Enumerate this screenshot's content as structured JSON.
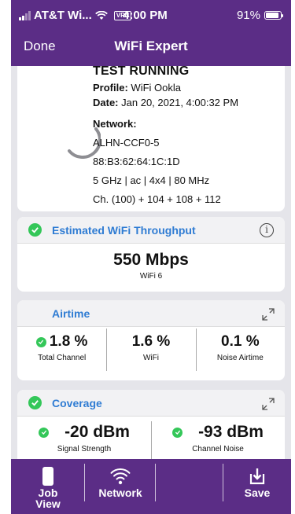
{
  "status_bar": {
    "carrier": "AT&T Wi...",
    "vpn": "VPN",
    "time": "4:00 PM",
    "battery": "91%"
  },
  "nav": {
    "done_label": "Done",
    "title": "WiFi Expert"
  },
  "test": {
    "status": "TEST RUNNING",
    "profile_label": "Profile:",
    "profile_value": "WiFi Ookla",
    "date_label": "Date:",
    "date_value": "Jan 20, 2021, 4:00:32 PM",
    "network_label": "Network:",
    "network_lines": [
      "ALHN-CCF0-5",
      "88:B3:62:64:1C:1D",
      "5 GHz | ac | 4x4 | 80 MHz",
      "Ch. (100) + 104 + 108 + 112"
    ]
  },
  "throughput": {
    "title": "Estimated WiFi Throughput",
    "value": "550 Mbps",
    "sub": "WiFi 6"
  },
  "airtime": {
    "title": "Airtime",
    "metrics": [
      {
        "value": "1.8 %",
        "label": "Total Channel"
      },
      {
        "value": "1.6 %",
        "label": "WiFi"
      },
      {
        "value": "0.1 %",
        "label": "Noise Airtime"
      }
    ]
  },
  "coverage": {
    "title": "Coverage",
    "metrics": [
      {
        "value": "-20 dBm",
        "label": "Signal Strength"
      },
      {
        "value": "-93 dBm",
        "label": "Channel Noise"
      }
    ]
  },
  "tabs": {
    "job_view": "Job View",
    "job_line1": "Job",
    "job_line2": "View",
    "network": "Network",
    "save": "Save"
  },
  "icons": {
    "wifi": "wifi-icon",
    "phone": "phone-icon",
    "save": "save-icon",
    "info": "info-icon",
    "expand": "expand-icon",
    "check": "check-icon"
  },
  "colors": {
    "brand": "#5b2d86",
    "accent": "#2f7cd3",
    "success": "#34c759"
  }
}
